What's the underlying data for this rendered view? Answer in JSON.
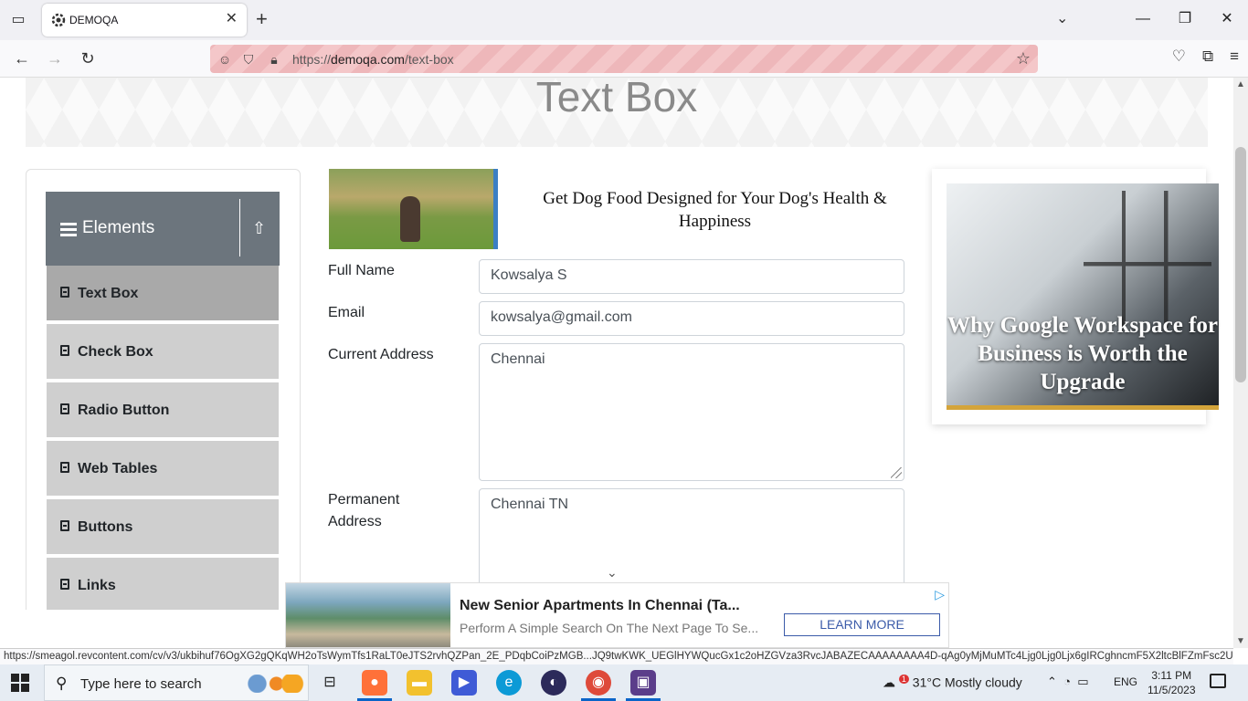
{
  "browser": {
    "tab_title": "DEMOQA",
    "url_prefix": "https://",
    "url_domain": "demoqa.com",
    "url_path": "/text-box",
    "status_url": "https://smeagol.revcontent.com/cv/v3/ukbihuf76OgXG2gQKqWH2oTsWymTfs1RaLT0eJTS2rvhQZPan_2E_PDqbCoiPzMGB...JQ9twKWK_UEGlHYWQucGx1c2oHZGVza3RvcJABAZECAAAAAAAA4D-qAg0yMjMuMTc4Ljg0Ljg0Ljx6gIRCghncmF5X2ltcBlFZmFsc2U"
  },
  "page": {
    "title": "Text Box"
  },
  "sidebar": {
    "group_title": "Elements",
    "items": [
      {
        "label": "Text Box",
        "active": true
      },
      {
        "label": "Check Box",
        "active": false
      },
      {
        "label": "Radio Button",
        "active": false
      },
      {
        "label": "Web Tables",
        "active": false
      },
      {
        "label": "Buttons",
        "active": false
      },
      {
        "label": "Links",
        "active": false
      }
    ]
  },
  "ad_top": {
    "text": "Get Dog Food Designed for Your Dog's Health & Happiness"
  },
  "form": {
    "full_name_label": "Full Name",
    "full_name_value": "Kowsalya S",
    "email_label": "Email",
    "email_value": "kowsalya@gmail.com",
    "current_address_label": "Current Address",
    "current_address_value": "Chennai",
    "permanent_address_label": "Permanent Address",
    "permanent_address_value": "Chennai TN"
  },
  "ad_right": {
    "text": "Why Google Workspace for Business is Worth the Upgrade"
  },
  "bottom_ad": {
    "title": "New Senior Apartments In Chennai (Ta...",
    "desc": "Perform A Simple Search On The Next Page To Se...",
    "button": "LEARN MORE"
  },
  "taskbar": {
    "search_placeholder": "Type here to search",
    "weather": "31°C  Mostly cloudy",
    "language": "ENG",
    "time": "3:11 PM",
    "date": "11/5/2023",
    "weather_badge": "1"
  },
  "colors": {
    "sidebar_header": "#6c757d",
    "sidebar_item": "#cfcfcf",
    "sidebar_item_active": "#a9a9a9",
    "learn_more": "#3b5ba9"
  }
}
